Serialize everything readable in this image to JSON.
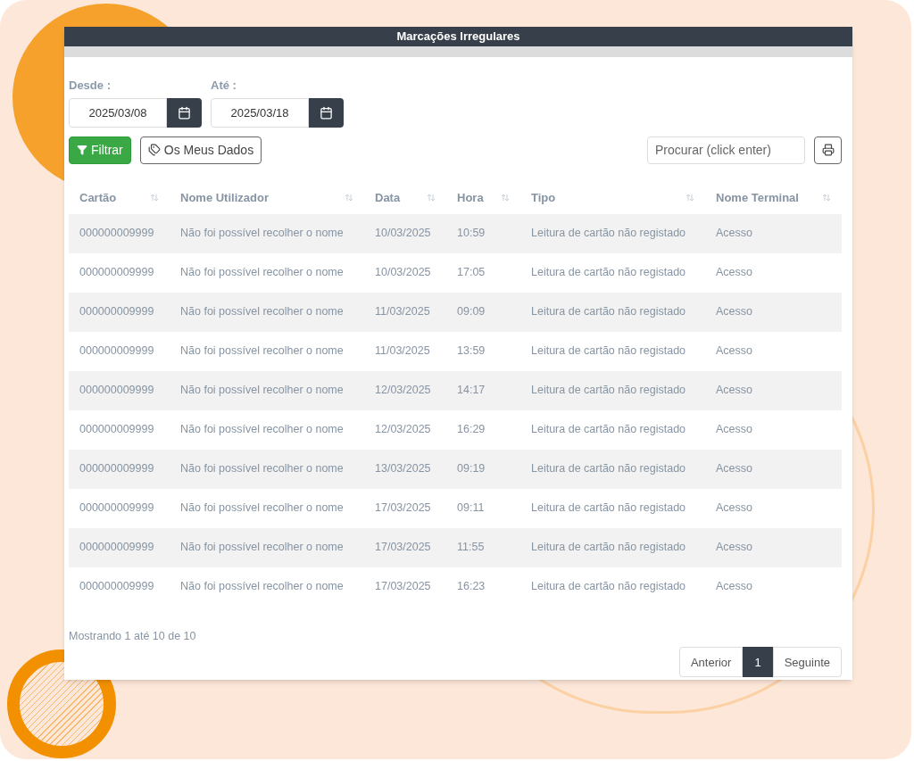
{
  "window": {
    "title": "Marcações Irregulares"
  },
  "date_from": {
    "label": "Desde :",
    "value": "2025/03/08"
  },
  "date_to": {
    "label": "Até :",
    "value": "2025/03/18"
  },
  "buttons": [
    {
      "kind": "filter",
      "label": "Filtrar"
    },
    {
      "kind": "tag",
      "label": "Os Meus Dados"
    }
  ],
  "search": {
    "placeholder": "Procurar (click enter)"
  },
  "table": {
    "columns": [
      "Cartão",
      "Nome Utilizador",
      "Data",
      "Hora",
      "Tipo",
      "Nome Terminal"
    ],
    "rows": [
      [
        "000000009999",
        "Não foi possível recolher o nome",
        "10/03/2025",
        "10:59",
        "Leitura de cartão não registado",
        "Acesso"
      ],
      [
        "000000009999",
        "Não foi possível recolher o nome",
        "10/03/2025",
        "17:05",
        "Leitura de cartão não registado",
        "Acesso"
      ],
      [
        "000000009999",
        "Não foi possível recolher o nome",
        "11/03/2025",
        "09:09",
        "Leitura de cartão não registado",
        "Acesso"
      ],
      [
        "000000009999",
        "Não foi possível recolher o nome",
        "11/03/2025",
        "13:59",
        "Leitura de cartão não registado",
        "Acesso"
      ],
      [
        "000000009999",
        "Não foi possível recolher o nome",
        "12/03/2025",
        "14:17",
        "Leitura de cartão não registado",
        "Acesso"
      ],
      [
        "000000009999",
        "Não foi possível recolher o nome",
        "12/03/2025",
        "16:29",
        "Leitura de cartão não registado",
        "Acesso"
      ],
      [
        "000000009999",
        "Não foi possível recolher o nome",
        "13/03/2025",
        "09:19",
        "Leitura de cartão não registado",
        "Acesso"
      ],
      [
        "000000009999",
        "Não foi possível recolher o nome",
        "17/03/2025",
        "09:11",
        "Leitura de cartão não registado",
        "Acesso"
      ],
      [
        "000000009999",
        "Não foi possível recolher o nome",
        "17/03/2025",
        "11:55",
        "Leitura de cartão não registado",
        "Acesso"
      ],
      [
        "000000009999",
        "Não foi possível recolher o nome",
        "17/03/2025",
        "16:23",
        "Leitura de cartão não registado",
        "Acesso"
      ]
    ]
  },
  "info": "Mostrando 1 até 10 de 10",
  "pagination": [
    {
      "label": "Anterior",
      "selected": false
    },
    {
      "label": "1",
      "selected": true
    },
    {
      "label": "Seguinte",
      "selected": false
    }
  ]
}
